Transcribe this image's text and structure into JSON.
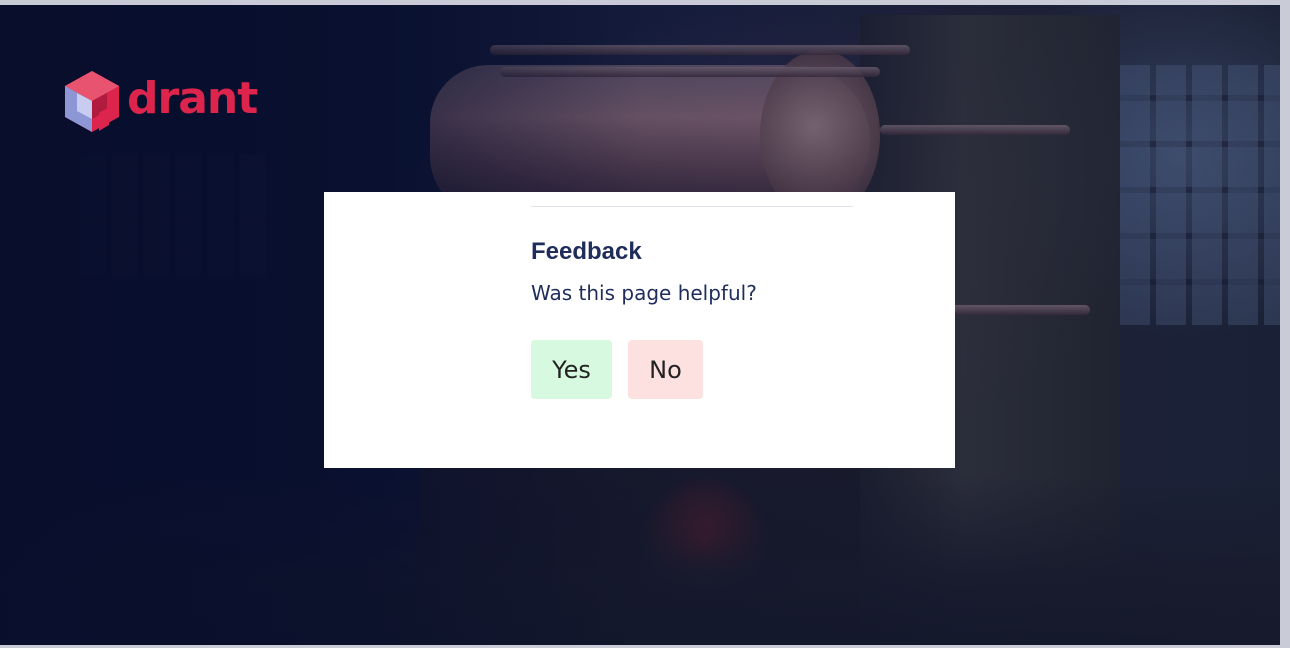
{
  "brand": {
    "logo_text": "drant",
    "logo_icon": "qdrant-cube-icon",
    "accent_color": "#dc244c"
  },
  "feedback": {
    "title": "Feedback",
    "question": "Was this page helpful?",
    "yes_label": "Yes",
    "no_label": "No",
    "title_color": "#1f2d5c",
    "yes_color": "#d6f9df",
    "no_color": "#fde0e0"
  }
}
